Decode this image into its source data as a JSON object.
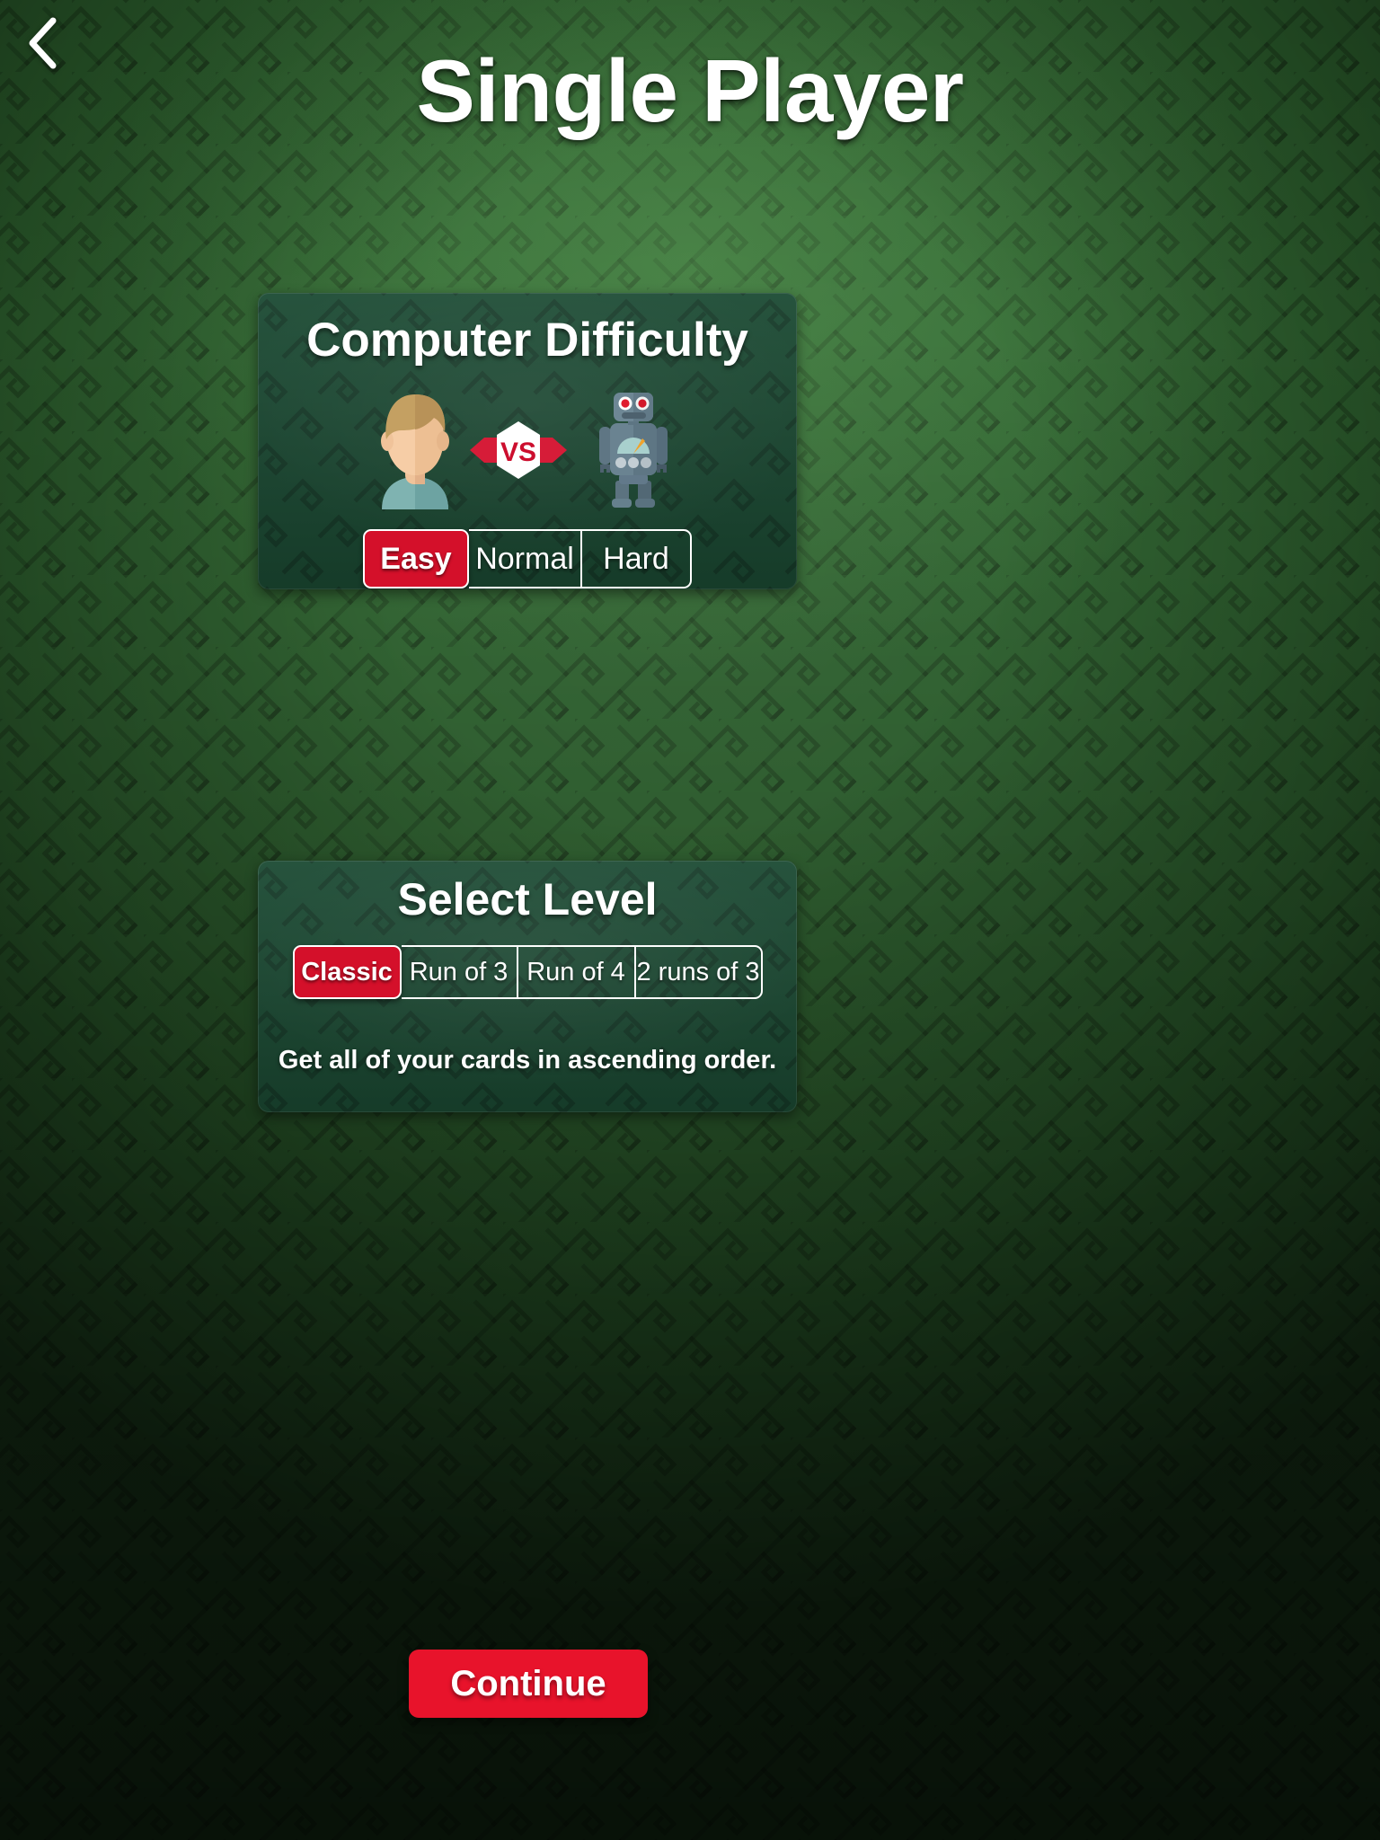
{
  "header": {
    "title": "Single Player",
    "back_icon": "chevron-left-icon"
  },
  "difficulty_card": {
    "title": "Computer Difficulty",
    "player_icon": "person-avatar-icon",
    "versus_label": "VS",
    "opponent_icon": "robot-icon",
    "options": [
      {
        "label": "Easy",
        "selected": true
      },
      {
        "label": "Normal",
        "selected": false
      },
      {
        "label": "Hard",
        "selected": false
      }
    ],
    "selected_option": "Easy"
  },
  "level_card": {
    "title": "Select Level",
    "options": [
      {
        "label": "Classic",
        "selected": true
      },
      {
        "label": "Run of 3",
        "selected": false
      },
      {
        "label": "Run of 4",
        "selected": false
      },
      {
        "label": "2 runs of 3",
        "selected": false
      }
    ],
    "selected_option": "Classic",
    "description": "Get all of your cards in ascending order."
  },
  "footer": {
    "continue_label": "Continue"
  },
  "colors": {
    "background_green": "#2f6630",
    "card_green": "#1b4a33",
    "accent_red": "#d4102a",
    "button_red": "#e8132b",
    "text_white": "#ffffff"
  }
}
